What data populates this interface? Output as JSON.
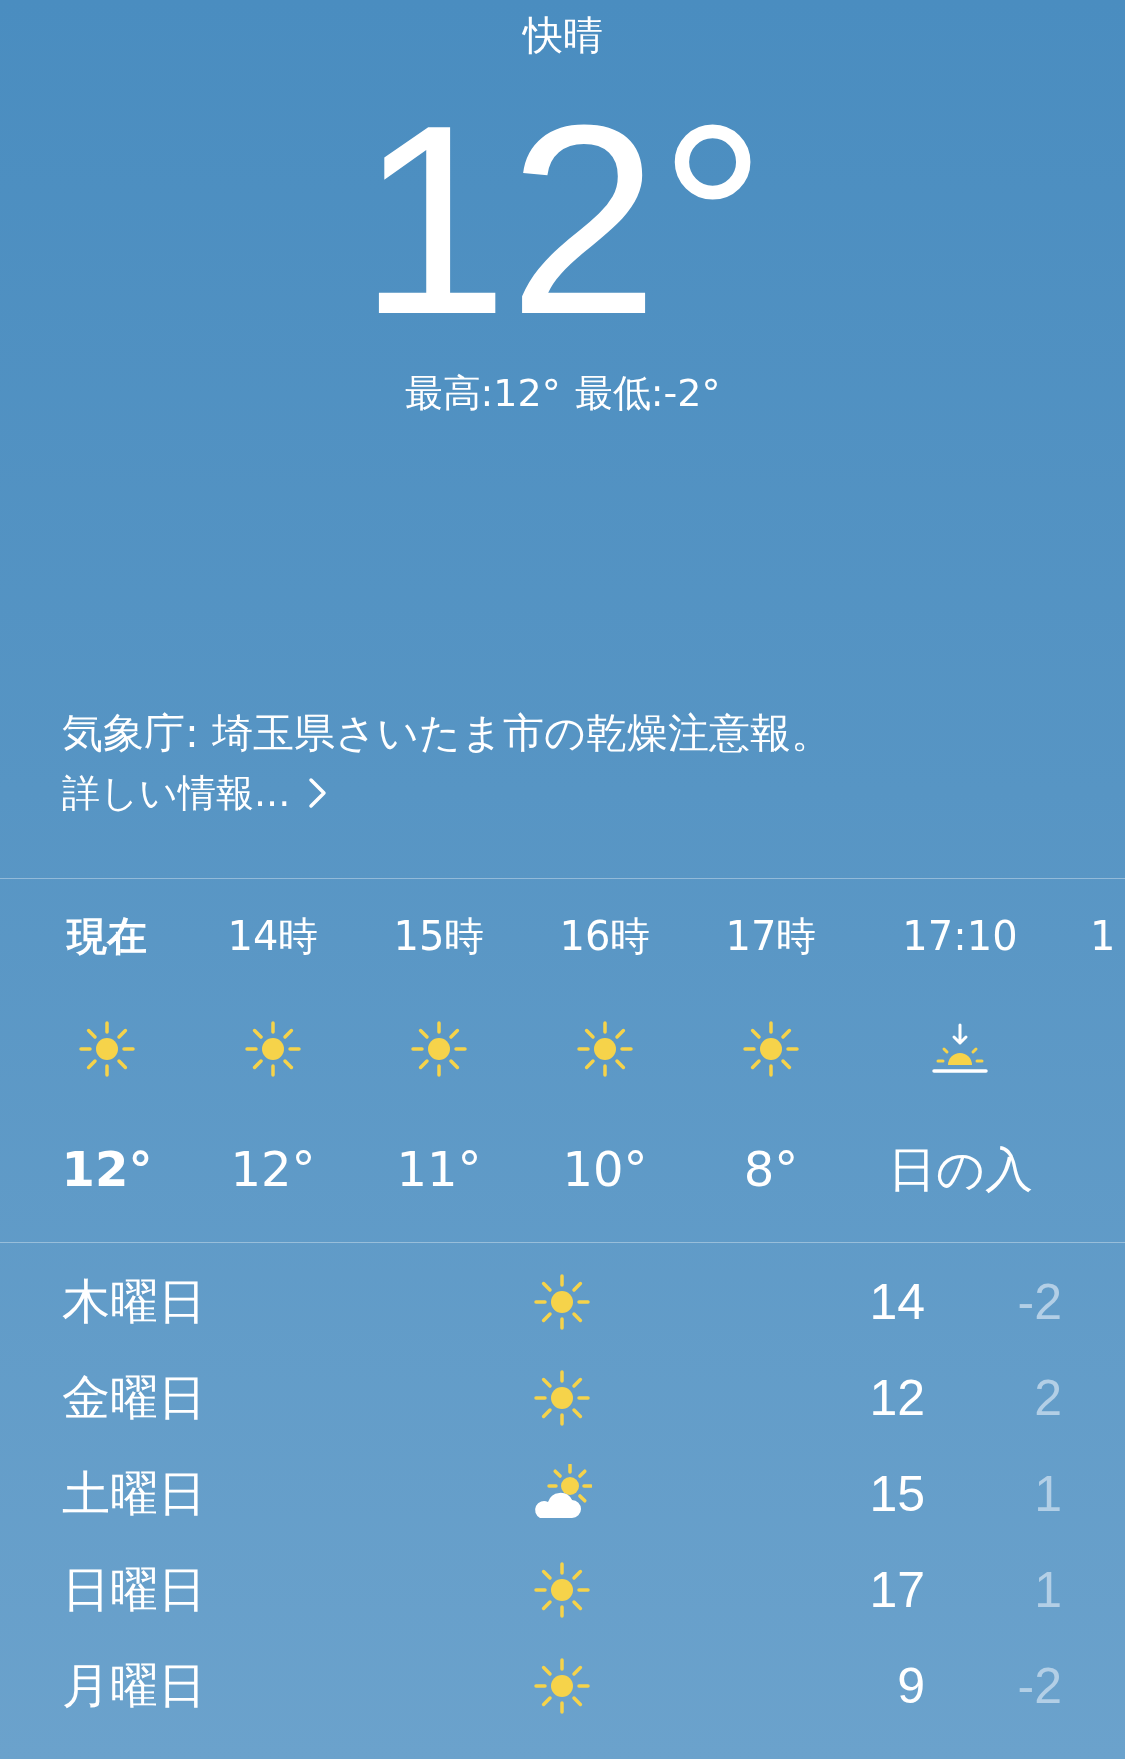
{
  "condition": "快晴",
  "temperature": "12°",
  "high": "最高:12°",
  "low": "最低:-2°",
  "alert": {
    "text": "気象庁: 埼玉県さいたま市の乾燥注意報。",
    "link": "詳しい情報..."
  },
  "hourly": [
    {
      "time": "現在",
      "kind": "sun",
      "temp": "12°",
      "current": true
    },
    {
      "time": "14時",
      "kind": "sun",
      "temp": "12°",
      "current": false
    },
    {
      "time": "15時",
      "kind": "sun",
      "temp": "11°",
      "current": false
    },
    {
      "time": "16時",
      "kind": "sun",
      "temp": "10°",
      "current": false
    },
    {
      "time": "17時",
      "kind": "sun",
      "temp": "8°",
      "current": false
    },
    {
      "time": "17:10",
      "kind": "sunset",
      "temp": "日の入",
      "current": false
    },
    {
      "time": "1",
      "kind": "cut",
      "current": false
    }
  ],
  "daily": [
    {
      "day": "木曜日",
      "kind": "sun",
      "high": "14",
      "low": "-2"
    },
    {
      "day": "金曜日",
      "kind": "sun",
      "high": "12",
      "low": "2"
    },
    {
      "day": "土曜日",
      "kind": "cloud-sun",
      "high": "15",
      "low": "1"
    },
    {
      "day": "日曜日",
      "kind": "sun",
      "high": "17",
      "low": "1"
    },
    {
      "day": "月曜日",
      "kind": "sun",
      "high": "9",
      "low": "-2"
    }
  ]
}
